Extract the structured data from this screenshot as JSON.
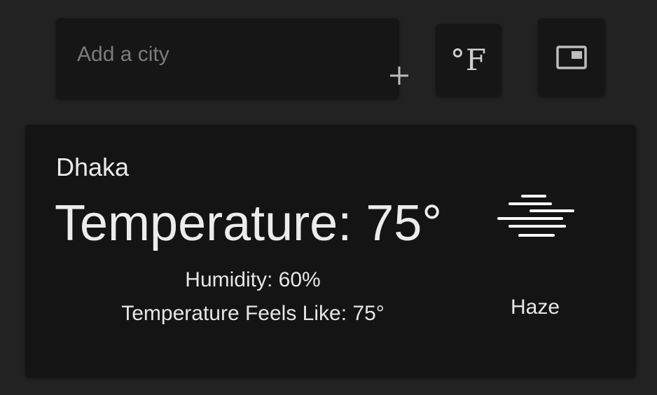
{
  "search": {
    "placeholder": "Add a city",
    "value": "",
    "add_icon": "plus-icon"
  },
  "toolbar": {
    "unit_label": "°F",
    "layout_icon": "picture-in-picture-icon"
  },
  "weather": {
    "city": "Dhaka",
    "temperature": "Temperature: 75°",
    "humidity": "Humidity: 60%",
    "feels_like": "Temperature Feels Like: 75°",
    "condition": "Haze",
    "condition_icon": "haze-icon"
  },
  "colors": {
    "background": "#222222",
    "card": "#141414",
    "text": "#e6e6e6",
    "placeholder": "#7c7c7c"
  }
}
